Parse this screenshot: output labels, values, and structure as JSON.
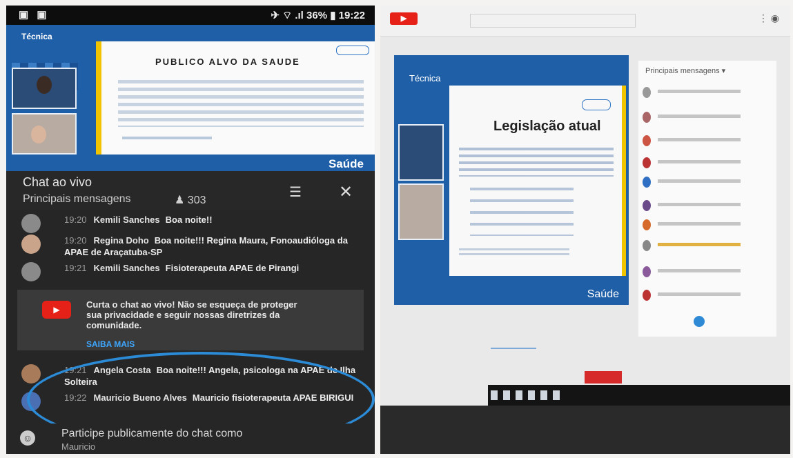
{
  "phone": {
    "status": {
      "left": "▣ ▣",
      "right": "✈ ⌔ .ıl 36% ▮ 19:22"
    },
    "video": {
      "brand": "Técnica",
      "slide_title": "PUBLICO ALVO DA SAUDE",
      "brand_bottom": "Saúde"
    },
    "chat": {
      "title": "Chat ao vivo",
      "subtitle": "Principais mensagens",
      "viewers": "303",
      "messages": [
        {
          "time": "19:20",
          "author": "Kemili Sanches",
          "text": "Boa noite!!"
        },
        {
          "time": "19:20",
          "author": "Regina Doho",
          "text": "Boa noite!!! Regina Maura, Fonoaudióloga da APAE de Araçatuba-SP"
        },
        {
          "time": "19:21",
          "author": "Kemili Sanches",
          "text": "Fisioterapeuta APAE de Pirangi"
        },
        {
          "time": "19:21",
          "author": "Angela Costa",
          "text": "Boa noite!!! Angela, psicologa na APAE de Ilha Solteira"
        },
        {
          "time": "19:22",
          "author": "Mauricio Bueno Alves",
          "text": "Mauricio fisioterapeuta APAE BIRIGUI"
        }
      ],
      "notice": {
        "text": "Curta o chat ao vivo! Não se esqueça de proteger sua privacidade e seguir nossas diretrizes da comunidade.",
        "link": "SAIBA MAIS"
      },
      "composer": {
        "placeholder": "Participe publicamente do chat como",
        "name": "Mauricio"
      }
    }
  },
  "laptop": {
    "brand": "Técnica",
    "slide_title": "Legislação atual",
    "brand_bottom": "Saúde",
    "chat_header": "Principais mensagens ▾"
  },
  "colors": {
    "accent_blue": "#1e5fa8",
    "highlight_circle": "#2c8bd6",
    "youtube_red": "#e62117"
  },
  "icons": [
    "filter-icon",
    "close-icon",
    "viewers-icon",
    "youtube-icon",
    "emoji-icon"
  ]
}
